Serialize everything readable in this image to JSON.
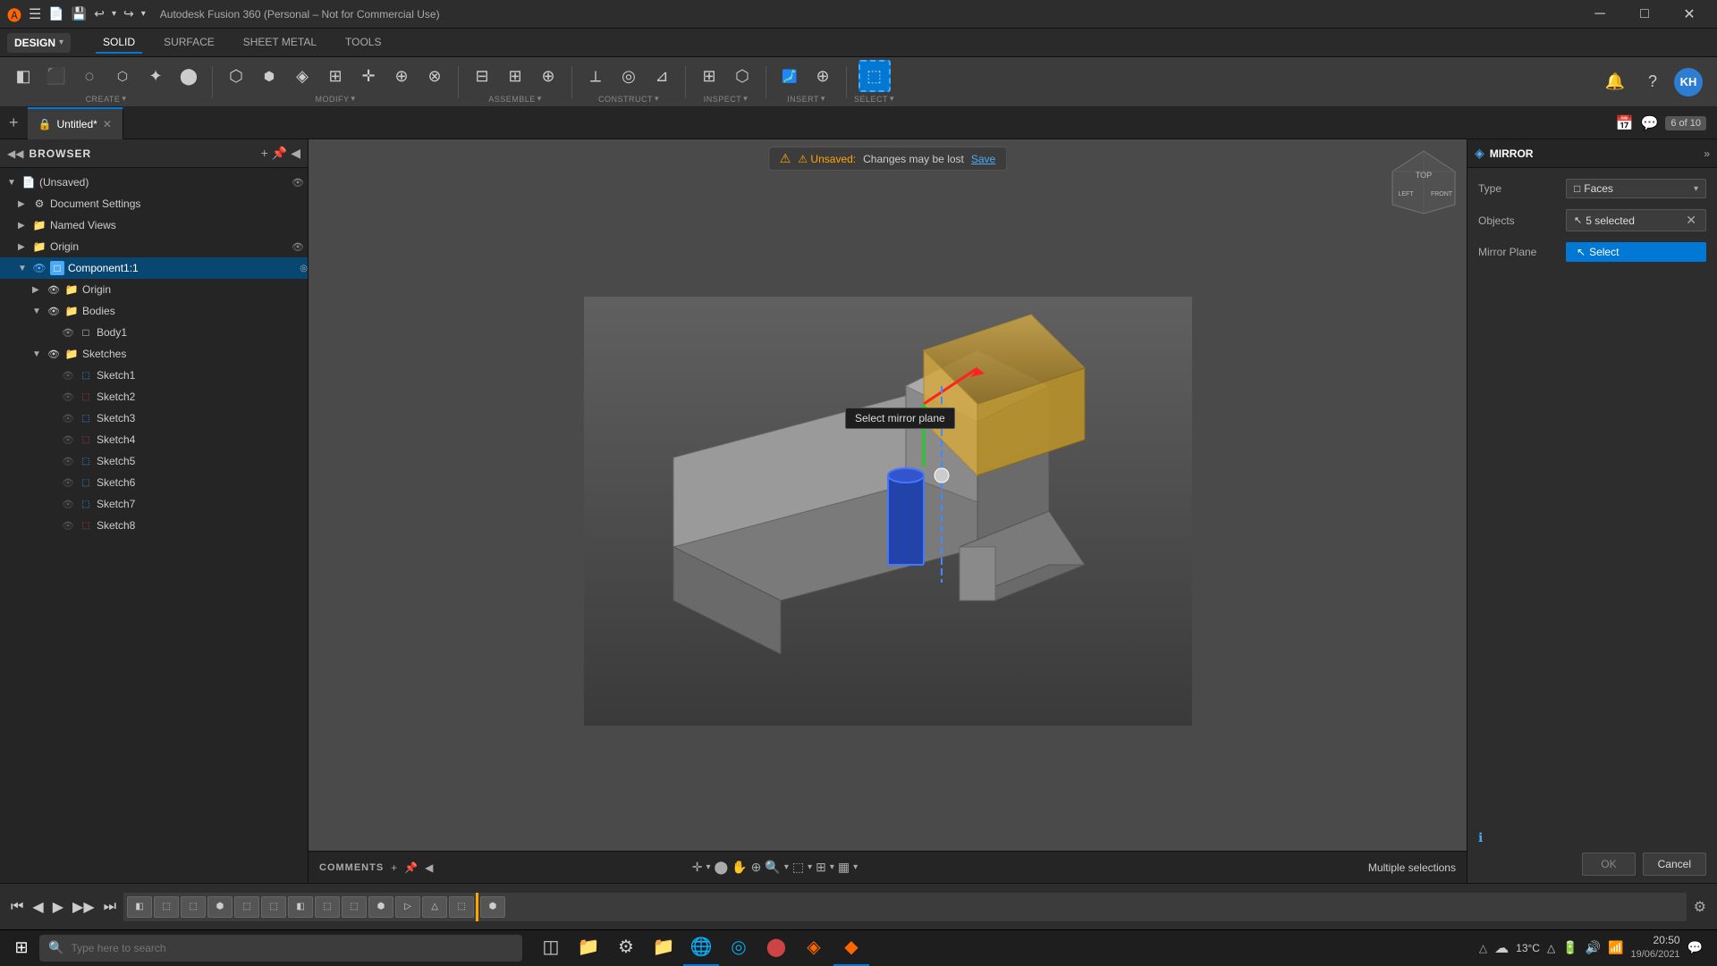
{
  "app": {
    "title": "Autodesk Fusion 360 (Personal – Not for Commercial Use)",
    "window_controls": {
      "minimize": "─",
      "maximize": "□",
      "close": "✕"
    }
  },
  "titlebar": {
    "logo": "🅐",
    "menu_items": [
      "≡",
      "📄",
      "💾",
      "↩",
      "↪"
    ],
    "app_name": "Autodesk Fusion 360 (Personal – Not for Commercial Use)"
  },
  "tabs_header": {
    "tab_label": "Untitled*",
    "tab_counter": "6 of 10",
    "tab_add": "+",
    "tab_close": "✕"
  },
  "toolbar": {
    "tabs": [
      "SOLID",
      "SURFACE",
      "SHEET METAL",
      "TOOLS"
    ],
    "active_tab": "SOLID",
    "design_label": "DESIGN",
    "sections": {
      "create": {
        "label": "CREATE",
        "icons": [
          "◧",
          "□",
          "◌",
          "⬡",
          "✦",
          "⬤"
        ]
      },
      "modify": {
        "label": "MODIFY",
        "icons": [
          "⬡",
          "⬢",
          "◈",
          "⊞",
          "✛",
          "⊕",
          "⊗"
        ]
      },
      "assemble": {
        "label": "ASSEMBLE",
        "icons": [
          "⊟",
          "⊞",
          "⊕"
        ]
      },
      "construct": {
        "label": "CONSTRUCT",
        "icons": [
          "⟂",
          "◎",
          "⊿"
        ]
      },
      "inspect": {
        "label": "INSPECT",
        "icons": [
          "⊞",
          "⬡"
        ]
      },
      "insert": {
        "label": "INSERT",
        "icons": [
          "🖼",
          "⊕"
        ]
      },
      "select": {
        "label": "SELECT",
        "icons": [
          "⬚"
        ]
      }
    }
  },
  "browser": {
    "title": "BROWSER",
    "collapse_icon": "◀◀",
    "pin_icon": "📌",
    "items": [
      {
        "level": 0,
        "label": "(Unsaved)",
        "arrow": "▼",
        "icon": "📄",
        "eye": true
      },
      {
        "level": 1,
        "label": "Document Settings",
        "arrow": "▶",
        "icon": "⚙",
        "eye": false
      },
      {
        "level": 1,
        "label": "Named Views",
        "arrow": "▶",
        "icon": "📁",
        "eye": false
      },
      {
        "level": 1,
        "label": "Origin",
        "arrow": "▶",
        "icon": "📁",
        "eye": true
      },
      {
        "level": 1,
        "label": "Component1:1",
        "arrow": "▼",
        "icon": "◉",
        "eye": true,
        "highlighted": true
      },
      {
        "level": 2,
        "label": "Origin",
        "arrow": "▶",
        "icon": "📁",
        "eye": true
      },
      {
        "level": 2,
        "label": "Bodies",
        "arrow": "▼",
        "icon": "📁",
        "eye": true
      },
      {
        "level": 3,
        "label": "Body1",
        "arrow": "",
        "icon": "□",
        "eye": true
      },
      {
        "level": 2,
        "label": "Sketches",
        "arrow": "▼",
        "icon": "📁",
        "eye": true
      },
      {
        "level": 3,
        "label": "Sketch1",
        "arrow": "",
        "icon": "⬚",
        "eye": false
      },
      {
        "level": 3,
        "label": "Sketch2",
        "arrow": "",
        "icon": "⬚",
        "eye": false
      },
      {
        "level": 3,
        "label": "Sketch3",
        "arrow": "",
        "icon": "⬚",
        "eye": false
      },
      {
        "level": 3,
        "label": "Sketch4",
        "arrow": "",
        "icon": "⬚",
        "eye": false
      },
      {
        "level": 3,
        "label": "Sketch5",
        "arrow": "",
        "icon": "⬚",
        "eye": false
      },
      {
        "level": 3,
        "label": "Sketch6",
        "arrow": "",
        "icon": "⬚",
        "eye": false
      },
      {
        "level": 3,
        "label": "Sketch7",
        "arrow": "",
        "icon": "⬚",
        "eye": false
      },
      {
        "level": 3,
        "label": "Sketch8",
        "arrow": "",
        "icon": "⬚",
        "eye": false
      }
    ]
  },
  "viewport": {
    "unsaved_warning": "⚠ Unsaved:",
    "unsaved_text": "Changes may be lost",
    "save_label": "Save",
    "tooltip": "Select mirror plane",
    "status_label": "Multiple selections"
  },
  "mirror_panel": {
    "title": "MIRROR",
    "icon": "◈",
    "expand_icon": "»",
    "type_label": "Type",
    "type_value": "Faces",
    "type_icon": "□",
    "objects_label": "Objects",
    "objects_selected": "5 selected",
    "objects_clear": "✕",
    "mirror_plane_label": "Mirror Plane",
    "select_label": "Select",
    "select_icon": "↖",
    "info_icon": "ℹ",
    "ok_label": "OK",
    "cancel_label": "Cancel"
  },
  "comments": {
    "title": "COMMENTS",
    "pin_icon": "📌",
    "expand_icon": "◀"
  },
  "timeline": {
    "play_first": "⏮",
    "play_prev": "◀",
    "play": "▶",
    "play_next": "▶▶",
    "play_last": "⏭",
    "settings_icon": "⚙",
    "items_count": 14
  },
  "taskbar": {
    "start_icon": "⊞",
    "search_placeholder": "Type here to search",
    "search_icon": "🔍",
    "apps": [
      {
        "icon": "⊞",
        "name": "start",
        "active": false
      },
      {
        "icon": "🔍",
        "name": "search",
        "active": false
      },
      {
        "icon": "◫",
        "name": "task-view",
        "active": false
      },
      {
        "icon": "📁",
        "name": "file-explorer",
        "active": false
      },
      {
        "icon": "⚙",
        "name": "settings",
        "active": false
      },
      {
        "icon": "📁",
        "name": "explorer2",
        "active": false
      },
      {
        "icon": "🌐",
        "name": "chrome",
        "active": true
      },
      {
        "icon": "◎",
        "name": "edge",
        "active": false
      },
      {
        "icon": "⬤",
        "name": "app1",
        "active": false
      },
      {
        "icon": "◆",
        "name": "fusion",
        "active": true
      }
    ],
    "systray": {
      "time": "20:50",
      "date": "19/06/2021",
      "temp": "13°C",
      "icons": [
        "△",
        "🔊",
        "📶",
        "🔋"
      ]
    }
  }
}
